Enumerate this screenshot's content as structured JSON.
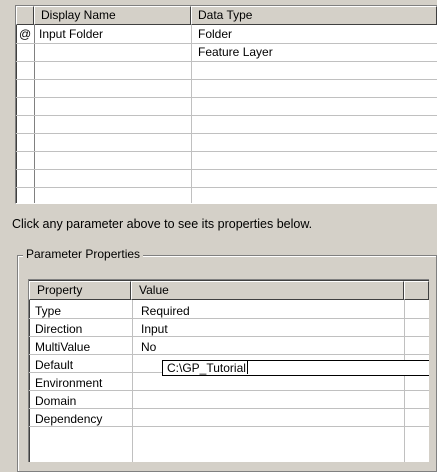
{
  "params_grid": {
    "headers": [
      "Display Name",
      "Data Type"
    ],
    "rows": [
      {
        "marker": "@",
        "name": "Input Folder",
        "type": "Folder"
      },
      {
        "marker": "",
        "name": "",
        "type": "Feature Layer"
      }
    ]
  },
  "instruction": "Click any parameter above to see its properties below.",
  "group": {
    "title": "Parameter Properties",
    "headers": [
      "Property",
      "Value"
    ],
    "rows": [
      {
        "property": "Type",
        "value": "Required"
      },
      {
        "property": "Direction",
        "value": "Input"
      },
      {
        "property": "MultiValue",
        "value": "No"
      },
      {
        "property": "Default",
        "value": "C:\\GP_Tutorial"
      },
      {
        "property": "Environment",
        "value": ""
      },
      {
        "property": "Domain",
        "value": ""
      },
      {
        "property": "Dependency",
        "value": ""
      }
    ]
  }
}
